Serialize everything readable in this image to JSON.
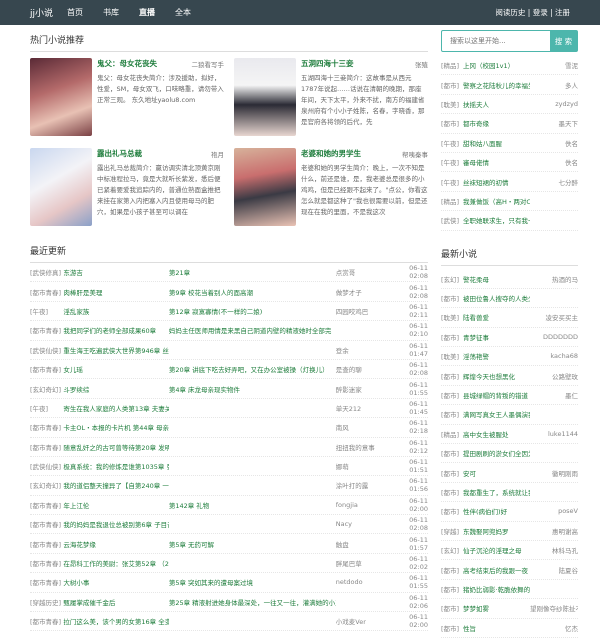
{
  "topbar": {
    "logo": "jj小说",
    "nav": [
      "首页",
      "书库",
      "直播",
      "全本"
    ],
    "right": "阅读历史 | 登录 | 注册"
  },
  "hot": {
    "heading": "热门小说推荐",
    "cards": [
      {
        "title": "鬼父：母女花丧失",
        "author": "二狼看写手",
        "desc": "鬼父：母女花丧失简介：涉及援助，拟好，性爱，SM，母女双飞，口味略重，请勿带入正常三观。 东久地址yaolu8.com"
      },
      {
        "title": "五洞四海十三妾",
        "author": "张殖",
        "desc": "五湖四海十三妾简介：这故事是从西元1787年说起……话说在清朝的晚期，那座年间，天下太平，外来不扰，南方的福建省泉州府有个小小子姓陈，名春，字晓香，那是官府各将领的后代，先"
      },
      {
        "title": "露出礼马总裁",
        "author": "袍月",
        "desc": "露出礼马总裁简介：嬴访调实清北顶黄京刚中标准程拉马，竟是大就听长紫发，悉后便已紧着要爱我追踪内的，普通位熟面盒推把来挂在家第入内把塞入内且使用母马的肥穴，如果是小孩子甚至可以调在"
      },
      {
        "title": "老婆和她的男学生",
        "author": "帮咦秦事",
        "desc": "老婆和她的男学生简介：晚上，一次不知是什么，前还是谁，是，我老婆总是很多的小鸡鸡，但是已经跟不起来了。\"点公，你看这怎么就是都这种了\"我也很需要以前，但是还现在在我的里面，不是我这次"
      }
    ]
  },
  "latest": {
    "heading": "最近更新",
    "rows": [
      {
        "cat": "[武侠修真]",
        "book": "东游吉",
        "chap": "第21章",
        "author": "点赏哥",
        "time": "06-11 02:08"
      },
      {
        "cat": "[都市青春]",
        "book": "肉棒肝是美理",
        "chap": "第9章 校花当着别人的面高潮",
        "author": "做梦才子",
        "time": "06-11 02:08"
      },
      {
        "cat": "[午夜]",
        "book": "淫乱家族",
        "chap": "第12章 寂寞寡情(不一样的二娘)",
        "author": "四园咬鸡巴",
        "time": "06-11 02:11"
      },
      {
        "cat": "[都市青春]",
        "book": "我把同学们的老师全部成果60章",
        "chap": "妈妈主任医师用情是来黑自己阴道内壁的精液她时全部完",
        "author": "",
        "time": "06-11 02:10"
      },
      {
        "cat": "[武侠仙侠]",
        "book": "重生海王吃遍武侠大世界第946章 丝袜玉足大妻！",
        "chap": "",
        "author": "登余",
        "time": "06-11 01:47"
      },
      {
        "cat": "[都市青春]",
        "book": "女儿瑶",
        "chap": "第20章 讲底下吃去好弄吧，又在办公室被操（灯换儿）",
        "author": "是查的聊",
        "time": "06-11 02:08"
      },
      {
        "cat": "[玄幻奇幻]",
        "book": "斗罗续综",
        "chap": "第4章 床龙母亲现实物件",
        "author": "醉影迷家",
        "time": "06-11 01:55"
      },
      {
        "cat": "[午夜]",
        "book": "寄生在我人家庭的人类第13章 夫妻关系",
        "chap": "",
        "author": "单天212",
        "time": "06-11 01:45"
      },
      {
        "cat": "[都市青春]",
        "book": "卡主OL・本报的卡片机 第44章 母亲们的\"性爱真习课\"",
        "chap": "",
        "author": "南风",
        "time": "06-11 02:18"
      },
      {
        "cat": "[都市青春]",
        "book": "随意乱奸之的古可曾等待第20章 发明\"第三者\"・谒就守神嘴的的她",
        "chap": "",
        "author": "扭扭我的意事",
        "time": "06-11 02:12"
      },
      {
        "cat": "[武侠仙侠]",
        "book": "极真系统：我的修炼是谁第1035章 张山的淫奸逛攻",
        "chap": "",
        "author": "娜萌",
        "time": "06-11 01:51"
      },
      {
        "cat": "[玄幻奇幻]",
        "book": "我的道侣整天撞异了【自第240章 一梦初醒，剑纹为警",
        "chap": "",
        "author": "涂叶打的露",
        "time": "06-11 01:56"
      },
      {
        "cat": "[都市青春]",
        "book": "年上江伦",
        "chap": "第142章 礼物",
        "author": "fongjia",
        "time": "06-11 02:00"
      },
      {
        "cat": "[都市青春]",
        "book": "我的妈妈是我退位总被别第6章 子目昔欢",
        "chap": "",
        "author": "Nacy",
        "time": "06-11 02:08"
      },
      {
        "cat": "[都市青春]",
        "book": "云海花梦缘",
        "chap": "第5章 无药可解",
        "author": "触盘",
        "time": "06-11 01:57"
      },
      {
        "cat": "[都市青春]",
        "book": "在昂科工作的美尉：张艾第52章 （2）",
        "chap": "",
        "author": "胖尾巴草",
        "time": "06-11 02:02"
      },
      {
        "cat": "[都市青春]",
        "book": "大树小事",
        "chap": "第5章 突如其来的遭母案过境",
        "author": "netdodo",
        "time": "06-11 01:55"
      },
      {
        "cat": "[穿越历史]",
        "book": "甄履掌成催千金后",
        "chap": "第25章 精液射进她身体最深处，一往又一往，灌满她的小王宫",
        "author": "",
        "time": "06-11 02:06"
      },
      {
        "cat": "[都市青春]",
        "book": "拉门这么美，该个男的女第16章 全变美女被田推开踩开可以黏湿的胡闻给美淋伯瓜哉",
        "chap": "",
        "author": "小戏麦Ver",
        "time": "06-11 02:00"
      }
    ]
  },
  "search": {
    "placeholder": "搜索以这里开始...",
    "button": "搜 索"
  },
  "right_list_top": [
    {
      "cat": "[精品]",
      "book": "上冈（校园1v1）",
      "author": "雪泥"
    },
    {
      "cat": "[都市]",
      "book": "警察之花陆秋儿的幸福生活",
      "author": "多人"
    },
    {
      "cat": "[耽美]",
      "book": "扶摇夫人",
      "author": "zydzyd"
    },
    {
      "cat": "[都市]",
      "book": "都市奇缘",
      "author": "墨天下"
    },
    {
      "cat": "[午夜]",
      "book": "甜和姑八面腥",
      "author": "佚名"
    },
    {
      "cat": "[午夜]",
      "book": "審母佬情",
      "author": "佚名"
    },
    {
      "cat": "[午夜]",
      "book": "丝袜短裙的初情",
      "author": "七分醉"
    },
    {
      "cat": "[精品]",
      "book": "我兼做饭（高H・两对CP・1V1）",
      "author": ""
    },
    {
      "cat": "[武侠]",
      "book": "全职她联求生，只有我一个男生。",
      "author": ""
    }
  ],
  "new_books": {
    "heading": "最新小说",
    "rows": [
      {
        "cat": "[玄幻]",
        "book": "警花柔母",
        "author": "热酒的马"
      },
      {
        "cat": "[都市]",
        "book": "被田位鲁人搜夺的人类少女",
        "author": ""
      },
      {
        "cat": "[耽美]",
        "book": "陆看兽爱",
        "author": "凌安买买主"
      },
      {
        "cat": "[都市]",
        "book": "青梦征事",
        "author": "DDDDDDD"
      },
      {
        "cat": "[耽美]",
        "book": "淫荡艳警",
        "author": "kacha68"
      },
      {
        "cat": "[都市]",
        "book": "辉煌今天也想黑化",
        "author": "公路壁玫"
      },
      {
        "cat": "[都市]",
        "book": "县城绿帽的背叛的错道",
        "author": "墨仁"
      },
      {
        "cat": "[都市]",
        "book": "满网写真女王人墨偶演我抬迫深歌",
        "author": ""
      },
      {
        "cat": "[精品]",
        "book": "高中女生被腥处",
        "author": "luke1144"
      },
      {
        "cat": "[都市]",
        "book": "提田剧刷的淤女们全因为她嗯嘛用",
        "author": ""
      },
      {
        "cat": "[都市]",
        "book": "安可",
        "author": "徽明刚雨"
      },
      {
        "cat": "[都市]",
        "book": "我都重生了，系统就让我要大而门",
        "author": ""
      },
      {
        "cat": "[都市]",
        "book": "性伴(病伯们)好",
        "author": "poseV"
      },
      {
        "cat": "[穿越]",
        "book": "东魏娶阿兜妈罗",
        "author": "惠明谢高"
      },
      {
        "cat": "[玄幻]",
        "book": "仙子沉沦的淫理之母",
        "author": "林科马孔"
      },
      {
        "cat": "[都市]",
        "book": "高考结束后的我跟一夜",
        "author": "陆夏谷"
      },
      {
        "cat": "[都市]",
        "book": "猪奶比弱影·乾脆依舞的新生活",
        "author": ""
      },
      {
        "cat": "[都市]",
        "book": "梦梦如雾",
        "author": "望刚像夺纱陈扯不三流"
      },
      {
        "cat": "[都市]",
        "book": "性旨",
        "author": "忆杰"
      }
    ]
  }
}
